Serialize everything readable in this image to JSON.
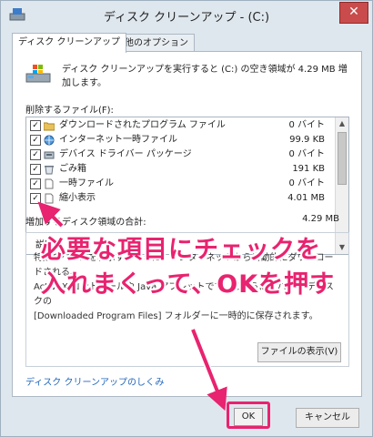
{
  "window": {
    "title": "ディスク クリーンアップ - (C:)",
    "close_label": "✕"
  },
  "tabs": [
    {
      "label": "ディスク クリーンアップ",
      "active": true
    },
    {
      "label": "その他のオプション",
      "active": false
    }
  ],
  "intro_text": "ディスク クリーンアップを実行すると (C:) の空き領域が 4.29 MB 増加します。",
  "list_label": "削除するファイル(F):",
  "files": [
    {
      "checked": true,
      "icon": "folder-icon",
      "name": "ダウンロードされたプログラム ファイル",
      "size": "0 バイト"
    },
    {
      "checked": true,
      "icon": "globe-icon",
      "name": "インターネット一時ファイル",
      "size": "99.9 KB"
    },
    {
      "checked": true,
      "icon": "driver-icon",
      "name": "デバイス ドライバー パッケージ",
      "size": "0 バイト"
    },
    {
      "checked": true,
      "icon": "recycle-bin-icon",
      "name": "ごみ箱",
      "size": "191 KB"
    },
    {
      "checked": true,
      "icon": "file-icon",
      "name": "一時ファイル",
      "size": "0 バイト"
    },
    {
      "checked": true,
      "icon": "file-icon",
      "name": "縮小表示",
      "size": "4.01 MB"
    }
  ],
  "gain": {
    "label": "増加するディスク領域の合計:",
    "value": "4.29 MB"
  },
  "description": {
    "title": "説明",
    "lines": [
      "特定のページを表示するときに、インターネットから自動的にダウンロードされる、",
      "ActiveX コントロールや Java アプレットです。これらは、ハード ディスクの",
      "[Downloaded Program Files] フォルダーに一時的に保存されます。"
    ]
  },
  "show_files_button": "ファイルの表示(V)",
  "help_link": "ディスク クリーンアップのしくみ",
  "ok_button": "OK",
  "cancel_button": "キャンセル",
  "annotation": {
    "line1": "必要な項目にチェックを",
    "line2": "入れまくって、OKを押す",
    "color": "#e8236f"
  }
}
